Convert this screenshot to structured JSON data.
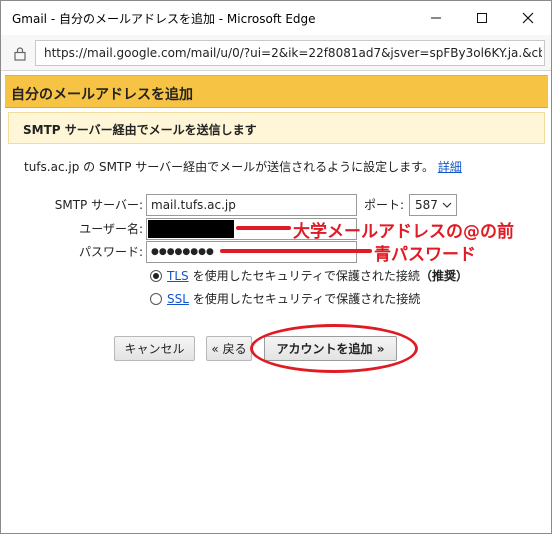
{
  "window": {
    "title": "Gmail - 自分のメールアドレスを追加 - Microsoft Edge",
    "url": "https://mail.google.com/mail/u/0/?ui=2&ik=22f8081ad7&jsver=spFBy3ol6KY.ja.&cbl=g"
  },
  "dialog": {
    "header": "自分のメールアドレスを追加",
    "section_title": "SMTP サーバー経由でメールを送信します",
    "description": "tufs.ac.jp の SMTP サーバー経由でメールが送信されるように設定します。",
    "details_link": "詳細",
    "smtp_label": "SMTP サーバー:",
    "smtp_value": "mail.tufs.ac.jp",
    "port_label": "ポート:",
    "port_value": "587",
    "username_label": "ユーザー名:",
    "password_label": "パスワード:",
    "password_value": "●●●●●●●●",
    "tls_link": "TLS",
    "tls_text": "を使用したセキュリティで保護された接続",
    "tls_recommended": "（推奨）",
    "ssl_link": "SSL",
    "ssl_text": "を使用したセキュリティで保護された接続",
    "cancel_button": "キャンセル",
    "back_button": "« 戻る",
    "add_account_button": "アカウントを追加 »"
  },
  "annotations": {
    "username_note": "大学メールアドレスの@の前",
    "password_note": "青パスワード",
    "color": "#e01b24"
  }
}
